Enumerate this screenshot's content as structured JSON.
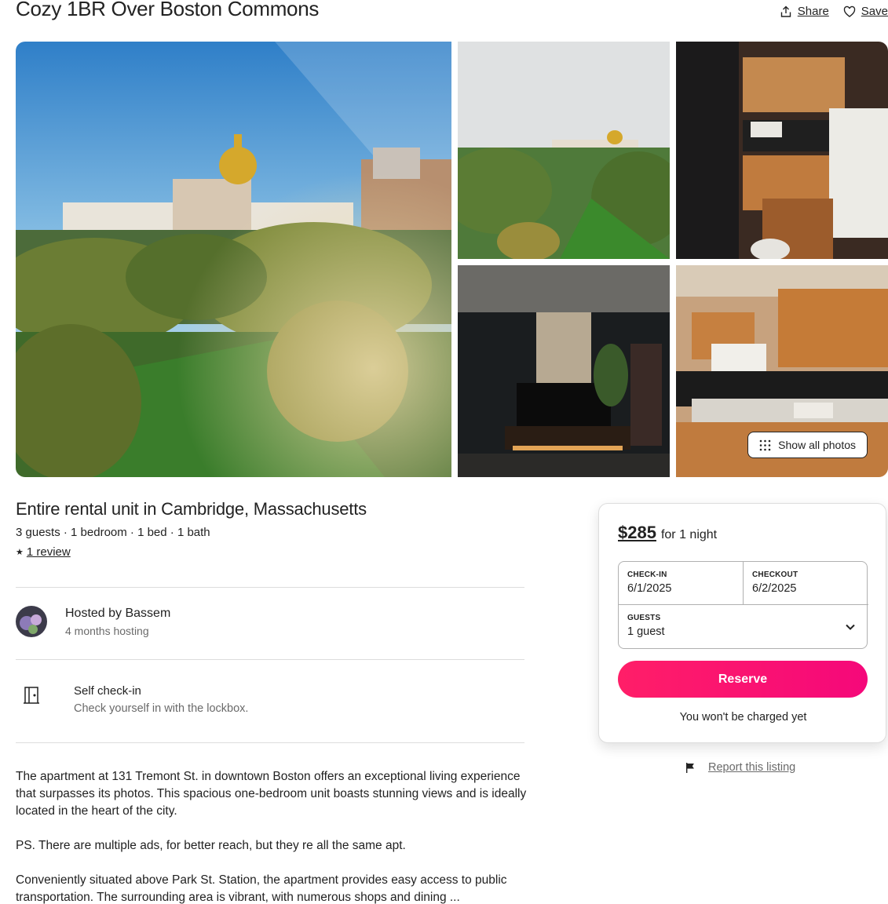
{
  "listing": {
    "title": "Cozy 1BR Over Boston Commons",
    "share_label": "Share",
    "save_label": "Save",
    "show_all_photos_label": "Show all photos",
    "subtitle": "Entire rental unit in Cambridge, Massachusetts",
    "specs": "3 guests · 1 bedroom · 1 bed · 1 bath",
    "review_star": "★",
    "review_link": "1 review"
  },
  "photos": [
    {
      "name": "state-house-view-photo"
    },
    {
      "name": "boston-common-overview-photo"
    },
    {
      "name": "kitchen-photo"
    },
    {
      "name": "living-room-photo"
    },
    {
      "name": "kitchen-counter-photo"
    }
  ],
  "host": {
    "name": "Hosted by Bassem",
    "tenure": "4 months hosting"
  },
  "features": [
    {
      "icon": "door-icon",
      "title": "Self check-in",
      "subtitle": "Check yourself in with the lockbox."
    }
  ],
  "description": [
    "The apartment at 131 Tremont St. in downtown Boston offers an exceptional living experience that surpasses its photos. This spacious one-bedroom unit boasts stunning views and is ideally located in the heart of the city.",
    "PS. There are multiple ads, for better reach, but they re all the same apt.",
    "Conveniently situated above Park St. Station, the apartment provides easy access to public transportation. The surrounding area is vibrant, with numerous shops and dining ..."
  ],
  "booking": {
    "price": "$285",
    "price_unit": "for 1 night",
    "checkin_label": "CHECK-IN",
    "checkin_value": "6/1/2025",
    "checkout_label": "CHECKOUT",
    "checkout_value": "6/2/2025",
    "guests_label": "GUESTS",
    "guests_value": "1 guest",
    "reserve_label": "Reserve",
    "no_charge_note": "You won't be charged yet"
  },
  "report_label": "Report this listing",
  "colors": {
    "accent": "#ff1e68",
    "text": "#222222",
    "muted": "#6a6a6a",
    "border": "#dddddd"
  }
}
